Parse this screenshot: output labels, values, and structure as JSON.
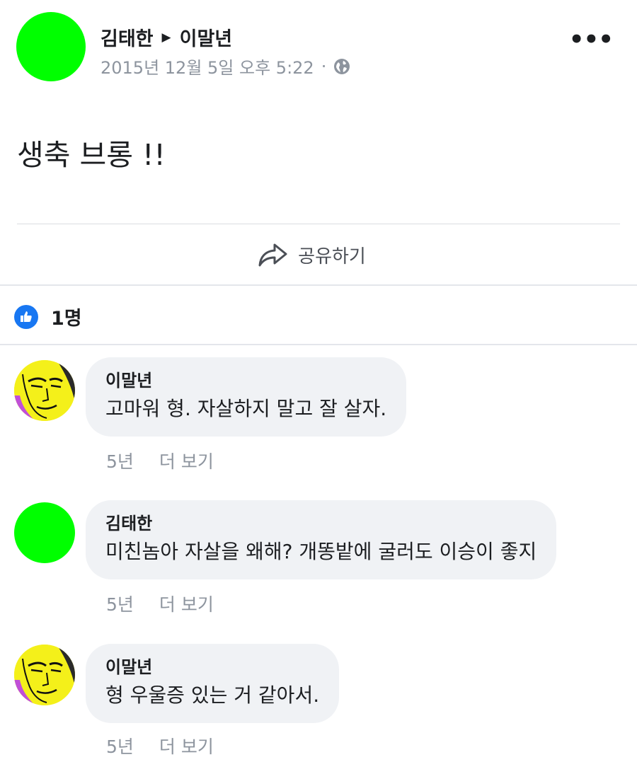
{
  "post": {
    "author": "김태한",
    "target": "이말년",
    "timestamp": "2015년 12월 5일 오후 5:22",
    "separator": "·",
    "privacy_icon": "globe-icon",
    "more_label": "•••",
    "text": "생축 브롱 !!",
    "share_label": "공유하기",
    "reactions_count": "1명"
  },
  "comments": [
    {
      "author": "이말년",
      "text": "고마워 형. 자살하지 말고 잘 살자.",
      "time": "5년",
      "more": "더 보기",
      "avatar": "face"
    },
    {
      "author": "김태한",
      "text": "미친놈아 자살을 왜해? 개똥밭에 굴러도 이승이 좋지",
      "time": "5년",
      "more": "더 보기",
      "avatar": "green"
    },
    {
      "author": "이말년",
      "text": "형 우울증 있는 거 같아서.",
      "time": "5년",
      "more": "더 보기",
      "avatar": "face"
    }
  ],
  "colors": {
    "avatar_green": "#00ff00",
    "like_blue": "#1877f2",
    "bubble_bg": "#f0f2f5",
    "meta_gray": "#8d949e"
  }
}
